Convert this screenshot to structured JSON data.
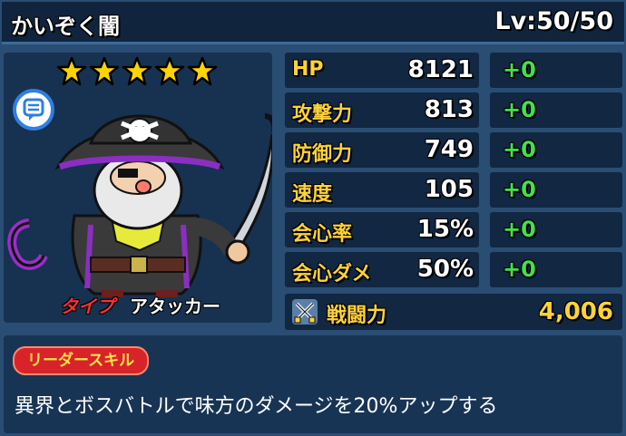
{
  "unit": {
    "name": "かいぞく闇",
    "level": "Lv:50/50",
    "star_count": 5,
    "type_label": "タイプ",
    "type_value": "アタッカー"
  },
  "stats": [
    {
      "label": "HP",
      "value": "8121",
      "bonus": "+0"
    },
    {
      "label": "攻撃力",
      "value": "813",
      "bonus": "+0"
    },
    {
      "label": "防御力",
      "value": "749",
      "bonus": "+0"
    },
    {
      "label": "速度",
      "value": "105",
      "bonus": "+0"
    },
    {
      "label": "会心率",
      "value": "15%",
      "bonus": "+0"
    },
    {
      "label": "会心ダメ",
      "value": "50%",
      "bonus": "+0"
    }
  ],
  "power": {
    "label": "戦闘力",
    "value": "4,006"
  },
  "leader_skill": {
    "title": "リーダースキル",
    "description": "異界とボスバトルで味方のダメージを20%アップする"
  },
  "colors": {
    "stat_label": "#ffd23a",
    "bonus": "#44e04a",
    "type_label": "#ff3030",
    "skill_badge": "#d8232a"
  },
  "icons": {
    "star": "star-icon",
    "speech": "speech-bubble-icon",
    "power": "crossed-swords-icon"
  }
}
